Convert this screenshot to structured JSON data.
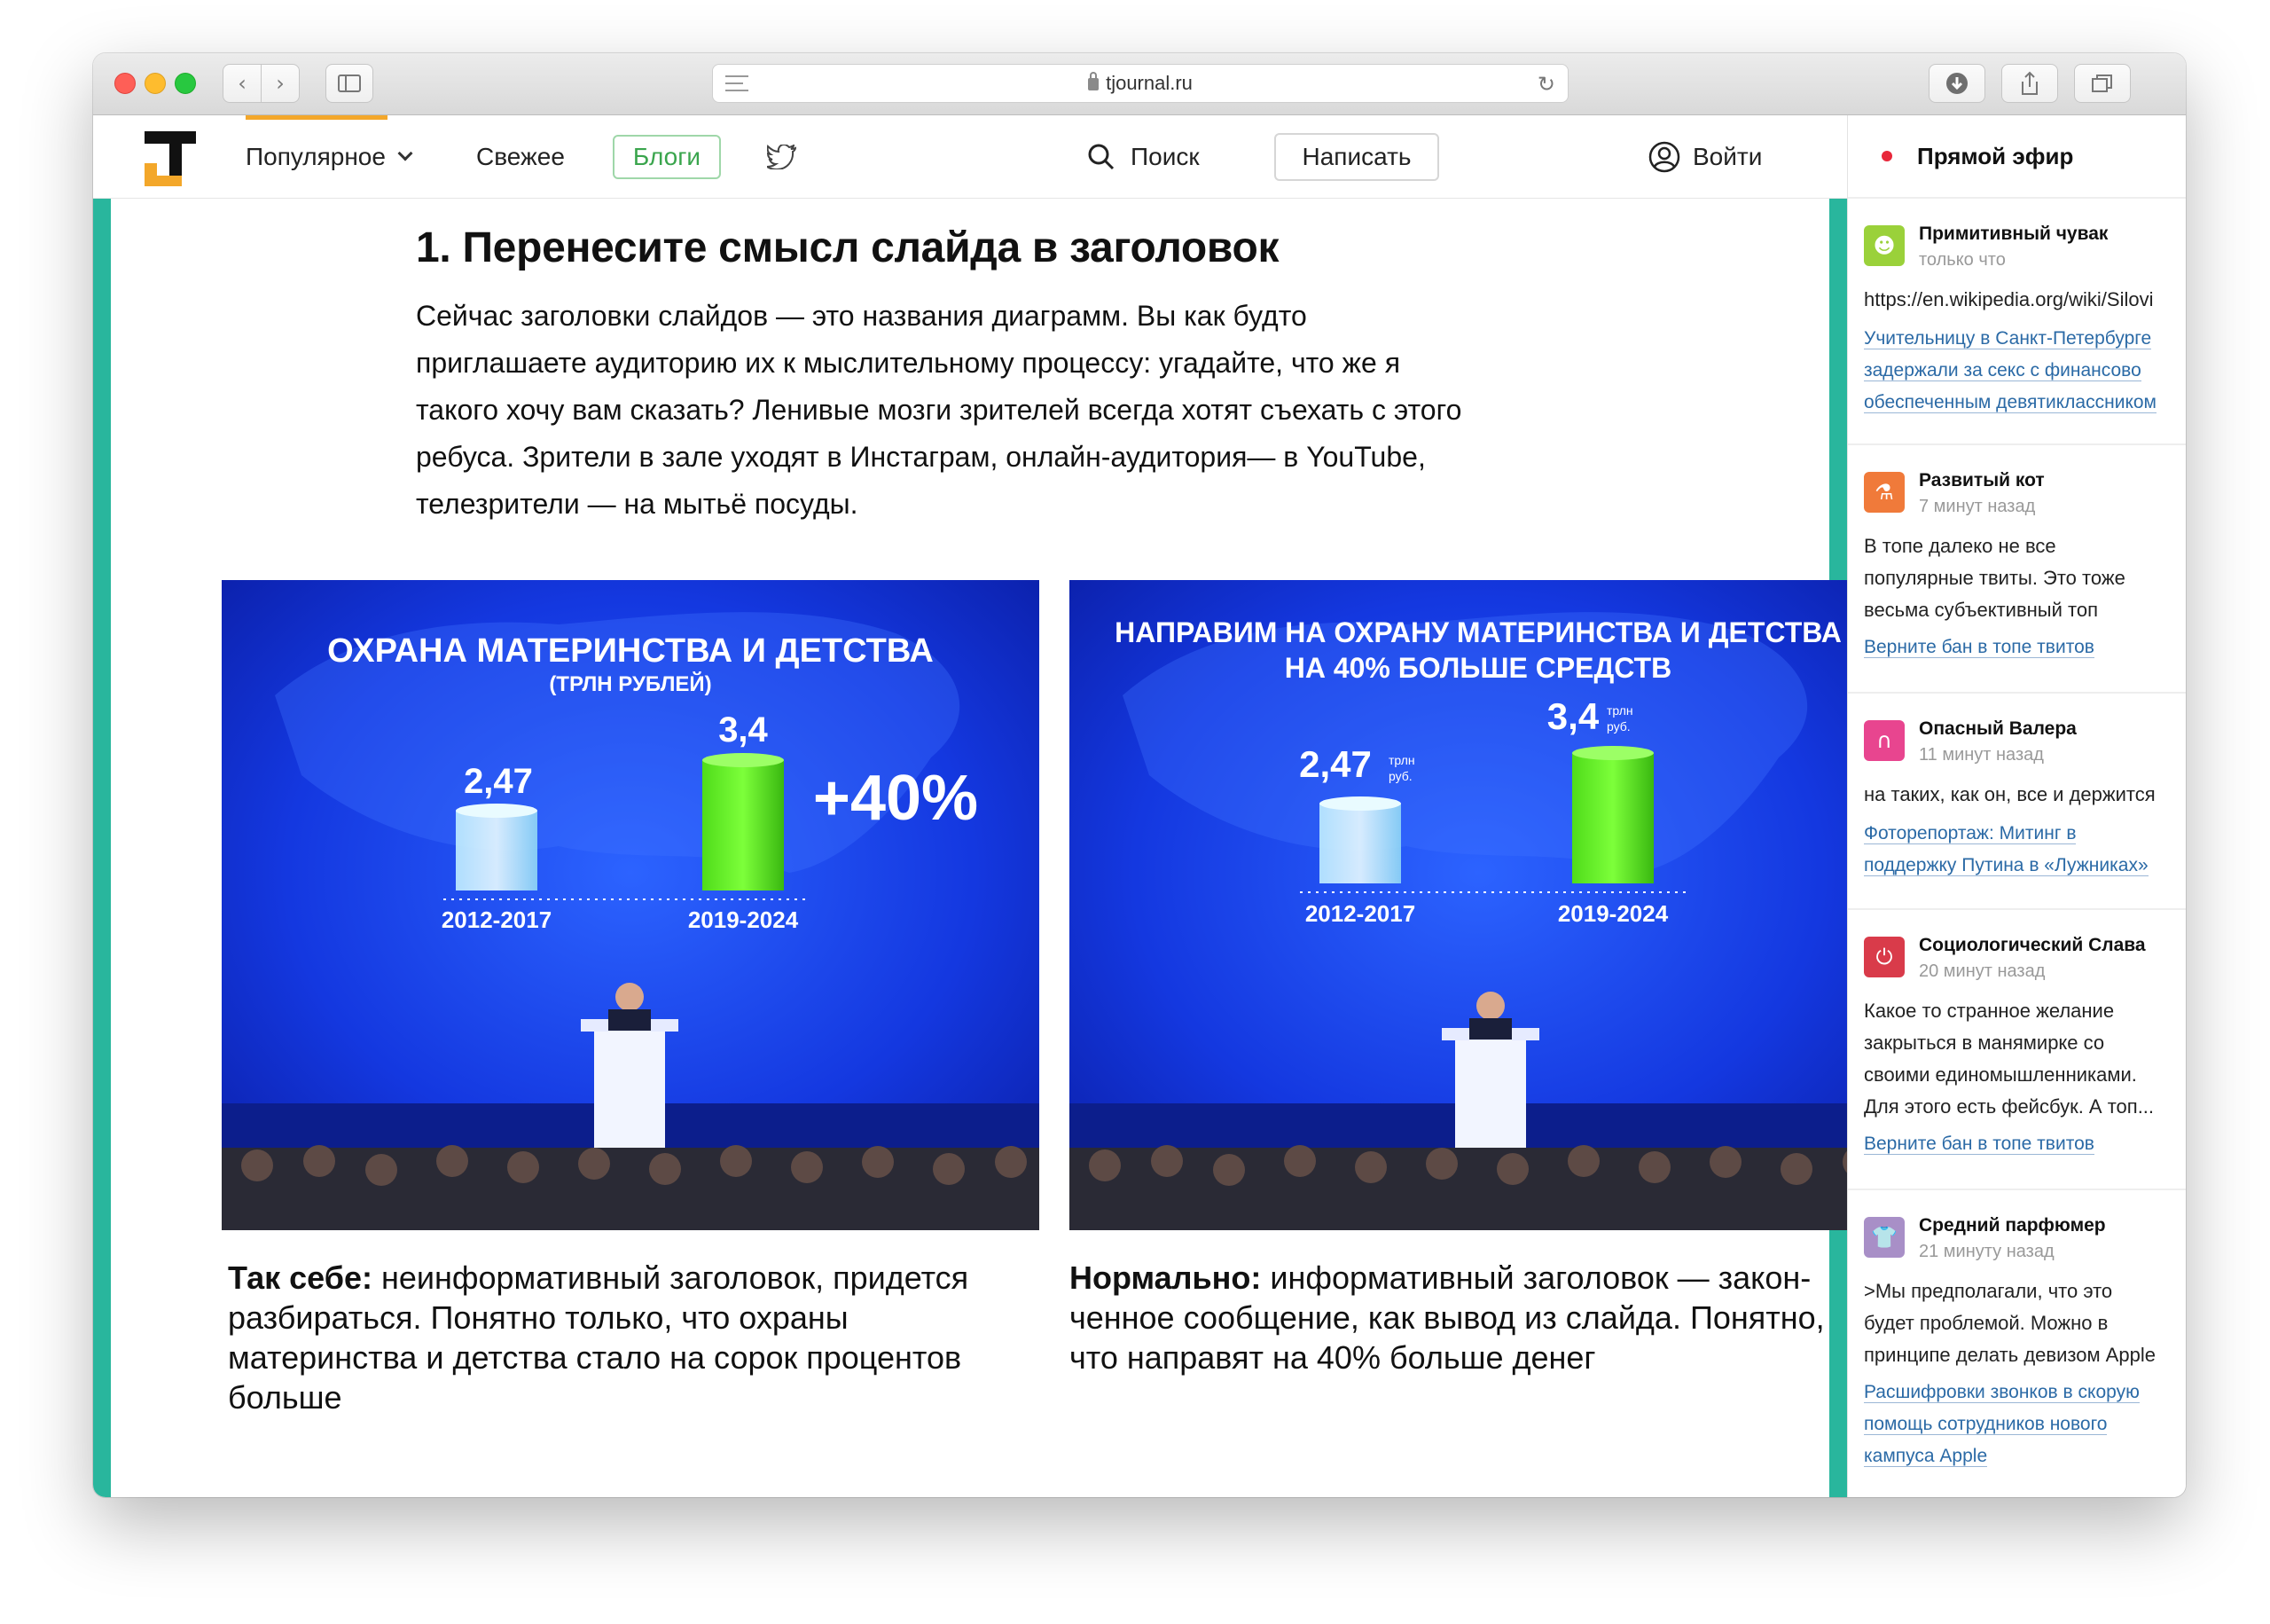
{
  "browser": {
    "url": "tjournal.ru",
    "new_tab_symbol": "+"
  },
  "header": {
    "nav": {
      "popular": "Популярное",
      "fresh": "Свежее",
      "blogs": "Блоги"
    },
    "search_label": "Поиск",
    "write_label": "Написать",
    "login_label": "Войти"
  },
  "article": {
    "heading": "1. Перенесите смысл слайда в заголовок",
    "paragraph_lines": [
      "Сейчас заголовки слайдов — это названия диаграмм. Вы как будто",
      "приглашаете аудиторию их к мыслительному процессу: угадайте, что же я",
      "такого хочу вам сказать? Ленивые мозги зрителей всегда хотят съехать с этого",
      "ребуса. Зрители в зале уходят в Инстаграм, онлайн-аудитория— в YouTube,",
      "телезрители — на мытьё посуды."
    ],
    "slides": [
      {
        "title_line1": "ОХРАНА МАТЕРИНСТВА И ДЕТСТВА",
        "title_line2": "(ТРЛН РУБЛЕЙ)",
        "value1": "2,47",
        "value2": "3,4",
        "extra": "+40%",
        "label1": "2012-2017",
        "label2": "2019-2024"
      },
      {
        "title_line1": "НАПРАВИМ НА ОХРАНУ МАТЕРИНСТВА И ДЕТСТВА",
        "title_line2": "НА 40% БОЛЬШЕ СРЕДСТВ",
        "value1": "2,47",
        "value2": "3,4",
        "unit1": "трлн",
        "unit2": "руб.",
        "label1": "2012-2017",
        "label2": "2019-2024"
      }
    ],
    "captions": [
      {
        "bold": "Так себе:",
        "lines": [
          " неинформативный заголовок, придется",
          "разбираться. Понятно только, что охраны",
          "материнства и детства стало на сорок процентов",
          "больше"
        ]
      },
      {
        "bold": "Нормально:",
        "lines": [
          " информативный заголовок — закон-",
          "ченное сообщение, как вывод из слайда. Понятно,",
          "что направят на 40% больше денег"
        ]
      }
    ]
  },
  "sidebar": {
    "title": "Прямой эфир",
    "items": [
      {
        "user": "Примитивный чувак",
        "time": "только что",
        "text_lines": [
          "https://en.wikipedia.org/wiki/Silovi"
        ],
        "link_lines": [
          "Учительницу в Санкт-Петербурге",
          "задержали за секс с финансово",
          "обеспеченным девятиклассником"
        ],
        "avatar_color": "#9ad13a",
        "avatar_icon": "alien-face-icon"
      },
      {
        "user": "Развитый кот",
        "time": "7 минут назад",
        "text_lines": [
          "В топе далеко не все",
          "популярные твиты. Это тоже",
          "весьма субъективный топ"
        ],
        "link_lines": [
          "Верните бан в топе твитов"
        ],
        "avatar_color": "#f07a3a",
        "avatar_icon": "flask-icon"
      },
      {
        "user": "Опасный Валера",
        "time": "11 минут назад",
        "text_lines": [
          "на таких, как он, все и держится"
        ],
        "link_lines": [
          "Фоторепортаж: Митинг в",
          "поддержку Путина в «Лужниках»"
        ],
        "avatar_color": "#e8458f",
        "avatar_icon": "magnet-icon"
      },
      {
        "user": "Социологический Слава",
        "time": "20 минут назад",
        "text_lines": [
          "Какое то странное желание",
          "закрыться в манямирке со",
          "своими единомышленниками.",
          "Для этого есть фейсбук. А топ..."
        ],
        "link_lines": [
          "Верните бан в топе твитов"
        ],
        "avatar_color": "#d93b4a",
        "avatar_icon": "power-icon"
      },
      {
        "user": "Средний парфюмер",
        "time": "21 минуту назад",
        "text_lines": [
          ">Мы предполагали, что это",
          "будет проблемой. Можно в",
          "принципе делать девизом Apple"
        ],
        "link_lines": [
          "Расшифровки звонков в скорую",
          "помощь сотрудников нового",
          "кампуса Apple"
        ],
        "avatar_color": "#a88fc7",
        "avatar_icon": "tshirt-icon"
      }
    ]
  },
  "colors": {
    "accent_teal": "#29b69d",
    "logo_orange": "#f3a72a",
    "blogs_green": "#3aa54d",
    "live_red": "#e8273a",
    "link_blue": "#2b6aa6"
  }
}
